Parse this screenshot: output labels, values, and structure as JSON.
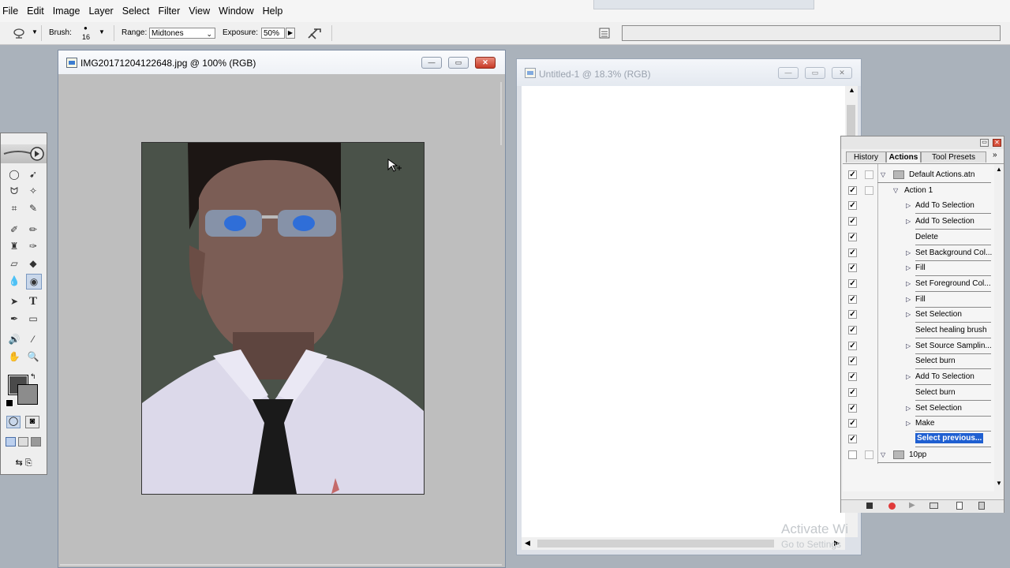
{
  "menubar": {
    "items": [
      "File",
      "Edit",
      "Image",
      "Layer",
      "Select",
      "Filter",
      "View",
      "Window",
      "Help"
    ]
  },
  "options": {
    "tool_icon": "burn-tool-icon",
    "brush_label": "Brush:",
    "brush_size": "16",
    "range_label": "Range:",
    "range_value": "Midtones",
    "exposure_label": "Exposure:",
    "exposure_value": "50%",
    "airbrush_icon": "airbrush-icon",
    "palette_well_icon": "palette-well-icon"
  },
  "doc1": {
    "title": "IMG20171204122648.jpg @ 100% (RGB)",
    "background_color": "#4a5249"
  },
  "doc2": {
    "title": "Untitled-1 @ 18.3% (RGB)"
  },
  "panel": {
    "tabs": [
      "History",
      "Actions",
      "Tool Presets"
    ],
    "active_tab": "Actions",
    "rows": [
      {
        "label": "Default Actions.atn",
        "type": "set",
        "checked": true,
        "expanded": true
      },
      {
        "label": "Action 1",
        "type": "action",
        "checked": true,
        "expanded": true
      },
      {
        "label": "Add To Selection",
        "type": "step",
        "checked": true,
        "has_arrow": true
      },
      {
        "label": "Add To Selection",
        "type": "step",
        "checked": true,
        "has_arrow": true
      },
      {
        "label": "Delete",
        "type": "step",
        "checked": true,
        "has_arrow": false
      },
      {
        "label": "Set Background Col...",
        "type": "step",
        "checked": true,
        "has_arrow": true
      },
      {
        "label": "Fill",
        "type": "step",
        "checked": true,
        "has_arrow": true
      },
      {
        "label": "Set Foreground Col...",
        "type": "step",
        "checked": true,
        "has_arrow": true
      },
      {
        "label": "Fill",
        "type": "step",
        "checked": true,
        "has_arrow": true
      },
      {
        "label": "Set Selection",
        "type": "step",
        "checked": true,
        "has_arrow": true
      },
      {
        "label": "Select healing brush",
        "type": "step",
        "checked": true,
        "has_arrow": false
      },
      {
        "label": "Set Source Samplin...",
        "type": "step",
        "checked": true,
        "has_arrow": true
      },
      {
        "label": "Select burn",
        "type": "step",
        "checked": true,
        "has_arrow": false
      },
      {
        "label": "Add To Selection",
        "type": "step",
        "checked": true,
        "has_arrow": true
      },
      {
        "label": "Select burn",
        "type": "step",
        "checked": true,
        "has_arrow": false
      },
      {
        "label": "Set Selection",
        "type": "step",
        "checked": true,
        "has_arrow": true
      },
      {
        "label": "Make",
        "type": "step",
        "checked": true,
        "has_arrow": true
      },
      {
        "label": "Select previous...",
        "type": "step",
        "checked": true,
        "has_arrow": false,
        "selected": true
      },
      {
        "label": "10pp",
        "type": "set",
        "checked": false,
        "expanded": true
      }
    ],
    "footer_icons": [
      "stop-icon",
      "record-icon",
      "play-icon",
      "new-set-icon",
      "new-action-icon",
      "delete-icon"
    ]
  },
  "watermark": {
    "line1": "Activate Wi",
    "line2": "Go to Settings"
  },
  "colors": {
    "selection": "#1f5fd1",
    "foreground_swatch": "#4a4a4a",
    "background_swatch": "#8c8c8c"
  }
}
